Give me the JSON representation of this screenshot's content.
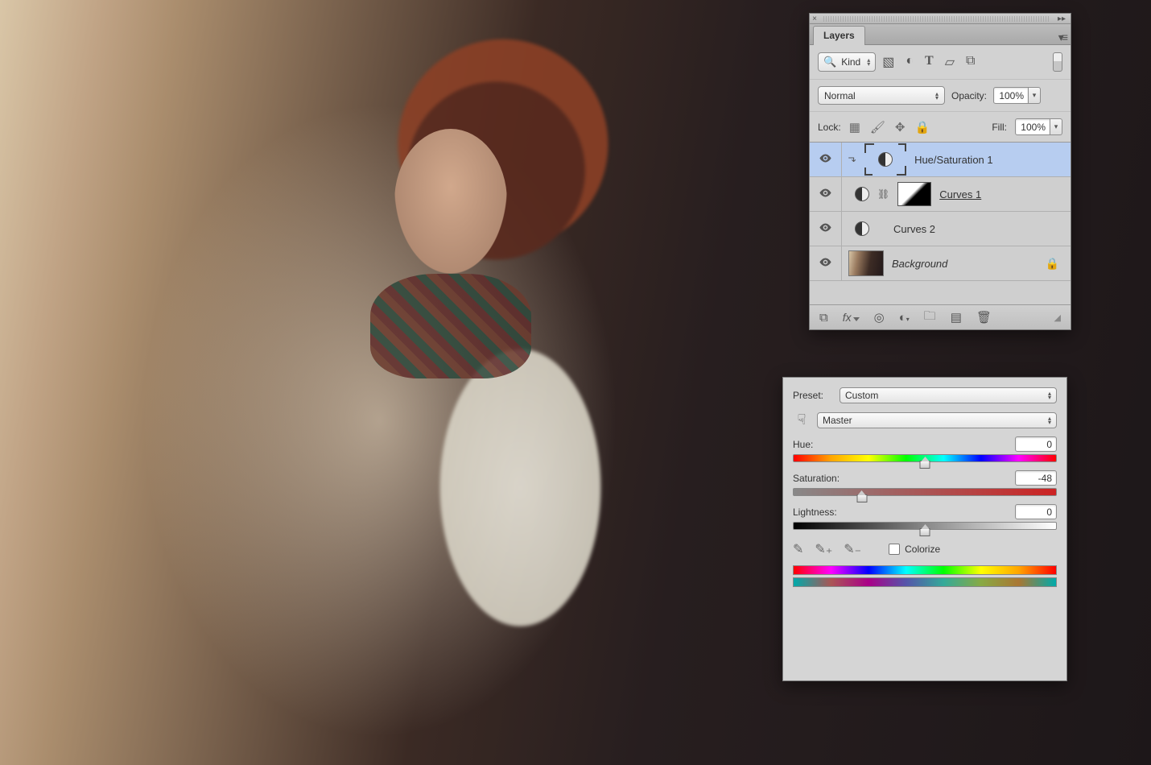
{
  "layers_panel": {
    "tab_label": "Layers",
    "filter_kind": "Kind",
    "blend_mode": "Normal",
    "opacity_label": "Opacity:",
    "opacity_value": "100%",
    "lock_label": "Lock:",
    "fill_label": "Fill:",
    "fill_value": "100%",
    "layers": [
      {
        "name": "Hue/Saturation 1",
        "type": "hue-sat",
        "selected": true,
        "clipped": true
      },
      {
        "name": "Curves 1",
        "type": "curves",
        "has_mask": true,
        "linked": true,
        "underline": true
      },
      {
        "name": "Curves 2",
        "type": "curves"
      },
      {
        "name": "Background",
        "type": "image",
        "locked": true,
        "italic": true
      }
    ]
  },
  "props_panel": {
    "preset_label": "Preset:",
    "preset_value": "Custom",
    "channel_value": "Master",
    "hue_label": "Hue:",
    "hue_value": "0",
    "hue_pos_pct": 50,
    "sat_label": "Saturation:",
    "sat_value": "-48",
    "sat_pos_pct": 26,
    "light_label": "Lightness:",
    "light_value": "0",
    "light_pos_pct": 50,
    "colorize_label": "Colorize"
  }
}
